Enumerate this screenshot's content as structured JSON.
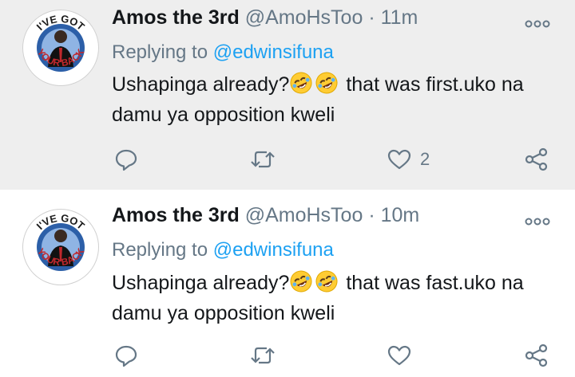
{
  "colors": {
    "accent": "#1da1f2",
    "muted": "#657786",
    "text": "#14171a",
    "highlight_bg": "#eeeeee"
  },
  "avatar_text": "I'VE GOT YOUR BACK",
  "tweets": [
    {
      "name": "Amos the 3rd",
      "handle": "@AmoHsToo",
      "separator": "·",
      "time": "11m",
      "replying_label": "Replying to",
      "replying_to": "@edwinsifuna",
      "text_before": "Ushapinga already?",
      "emojis": [
        "rolling-on-floor-laughing",
        "rolling-on-floor-laughing"
      ],
      "text_after": " that was first.uko na damu ya opposition kweli",
      "like_count": "2",
      "icons": [
        "reply-icon",
        "retweet-icon",
        "like-icon",
        "share-icon",
        "more-icon"
      ]
    },
    {
      "name": "Amos the 3rd",
      "handle": "@AmoHsToo",
      "separator": "·",
      "time": "10m",
      "replying_label": "Replying to",
      "replying_to": "@edwinsifuna",
      "text_before": "Ushapinga already?",
      "emojis": [
        "rolling-on-floor-laughing",
        "rolling-on-floor-laughing"
      ],
      "text_after": " that was fast.uko na damu ya opposition kweli",
      "like_count": "",
      "icons": [
        "reply-icon",
        "retweet-icon",
        "like-icon",
        "share-icon",
        "more-icon"
      ]
    }
  ]
}
